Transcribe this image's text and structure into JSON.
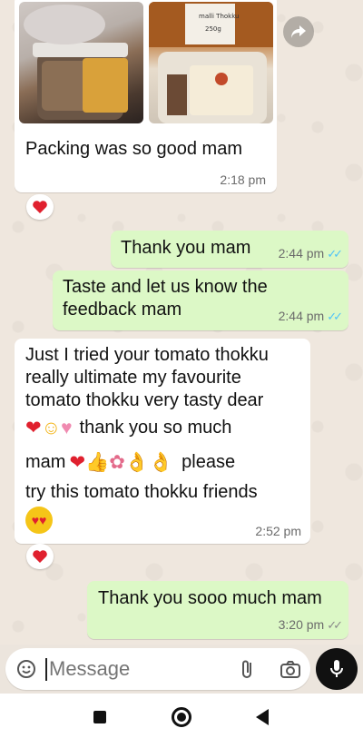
{
  "messages": [
    {
      "id": "m1",
      "direction": "incoming",
      "text": "Packing was so good mam",
      "time": "2:18 pm",
      "reaction": "heart",
      "has_images": true,
      "images": [
        {
          "alt_labels": []
        },
        {
          "alt_labels": [
            "malli Thokku",
            "250g"
          ]
        }
      ]
    },
    {
      "id": "m2",
      "direction": "outgoing",
      "text": "Thank you mam",
      "time": "2:44 pm",
      "status": "read"
    },
    {
      "id": "m3",
      "direction": "outgoing",
      "text_line1": "Taste and let us know the",
      "text_line2": "feedback mam",
      "time": "2:44 pm",
      "status": "read"
    },
    {
      "id": "m4",
      "direction": "incoming",
      "line1": "Just I tried your tomato thokku",
      "line2": "really ultimate my favourite",
      "line3": "tomato thokku very tasty dear",
      "line4_text": "thank you so much",
      "line5_pre": "mam",
      "line5_post": "please",
      "line6": "try this tomato thokku friends",
      "time": "2:52 pm",
      "reaction": "heart"
    },
    {
      "id": "m5",
      "direction": "outgoing",
      "text": "Thank you sooo much mam",
      "time": "3:20 pm",
      "status": "delivered"
    }
  ],
  "composer": {
    "placeholder": "Message"
  },
  "icons": {
    "forward": "forward-icon",
    "emoji": "emoji-icon",
    "attach": "paperclip-icon",
    "camera": "camera-icon",
    "mic": "mic-icon",
    "nav_recents": "square-icon",
    "nav_home": "circle-icon",
    "nav_back": "triangle-back-icon"
  },
  "colors": {
    "incoming": "#ffffff",
    "outgoing": "#dcf8c6",
    "read_ticks": "#4fc3f7",
    "background": "#efe7de"
  }
}
